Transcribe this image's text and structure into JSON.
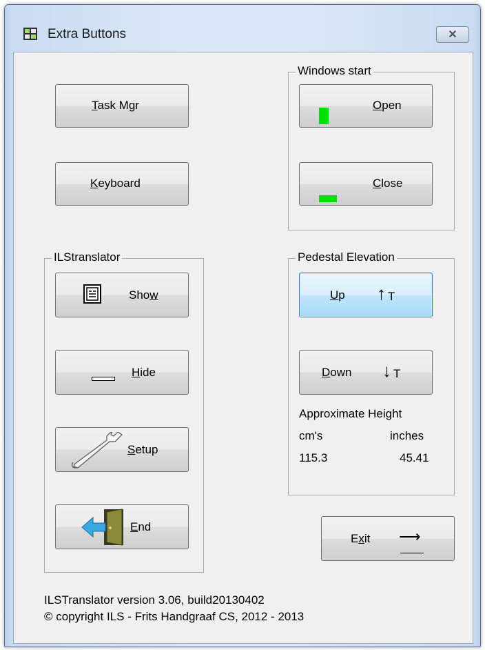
{
  "window": {
    "title": "Extra Buttons",
    "close_symbol": "✕"
  },
  "buttons": {
    "task_mgr": {
      "pre": "",
      "ul": "T",
      "post": "ask Mgr"
    },
    "keyboard": {
      "pre": "",
      "ul": "K",
      "post": "eyboard"
    },
    "open": {
      "pre": "",
      "ul": "O",
      "post": "pen"
    },
    "close": {
      "pre": "",
      "ul": "C",
      "post": "lose"
    },
    "show": {
      "pre": "Sho",
      "ul": "w",
      "post": ""
    },
    "hide": {
      "pre": "",
      "ul": "H",
      "post": "ide"
    },
    "setup": {
      "pre": "",
      "ul": "S",
      "post": "etup"
    },
    "end": {
      "pre": "",
      "ul": "E",
      "post": "nd"
    },
    "up": {
      "pre": "",
      "ul": "U",
      "post": "p"
    },
    "down": {
      "pre": "",
      "ul": "D",
      "post": "own"
    },
    "exit": {
      "pre": "E",
      "ul": "x",
      "post": "it"
    }
  },
  "groups": {
    "windows_start": "Windows start",
    "ils_translator": "ILStranslator",
    "pedestal_elevation": "Pedestal Elevation"
  },
  "height": {
    "title": "Approximate Height",
    "cm_label": "cm's",
    "inch_label": "inches",
    "cm_value": "115.3",
    "inch_value": "45.41"
  },
  "footer": {
    "version": "ILSTranslator version 3.06, build20130402",
    "copyright": "© copyright ILS - Frits Handgraaf CS, 2012 - 2013"
  },
  "colors": {
    "indicator": "#00e000",
    "titlebar": "#dbe8f7",
    "client_bg": "#f0f0f0"
  },
  "indicators": {
    "open_level": 0.55,
    "close_level": 0.25
  },
  "arrow_symbols": {
    "up": "↑",
    "down": "↓",
    "t": "T",
    "right": "⟶"
  }
}
